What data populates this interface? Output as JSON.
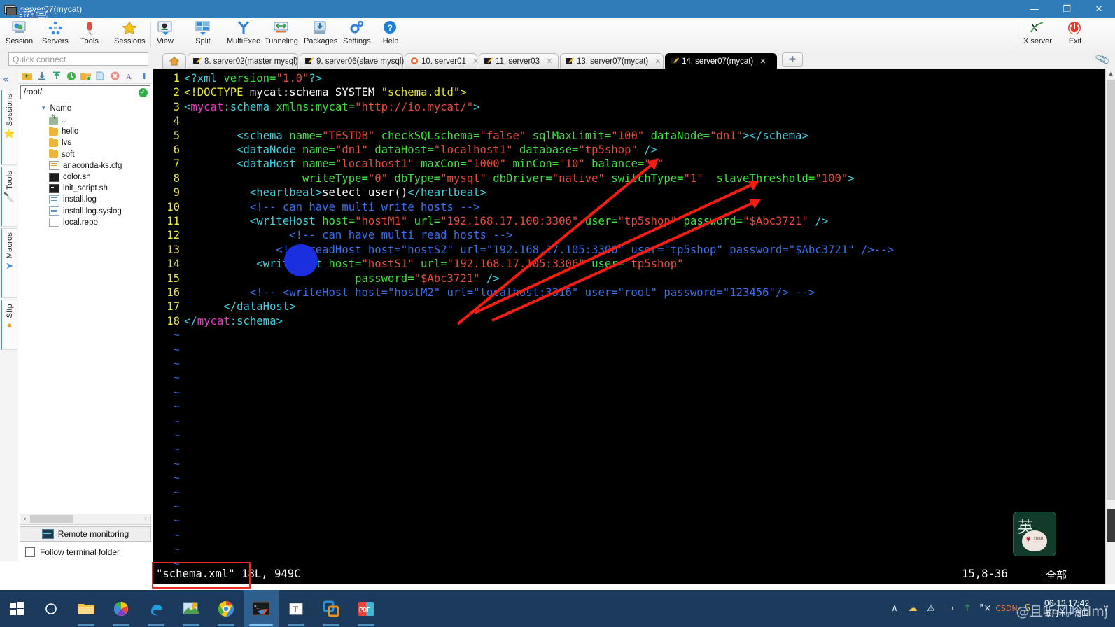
{
  "window": {
    "title": "server07(mycat)",
    "watermark_overlay": "暂停",
    "minimize_label": "—",
    "maximize_label": "❐",
    "close_label": "✕"
  },
  "ribbon": {
    "items": [
      {
        "label": "Session",
        "icon": "session-icon"
      },
      {
        "label": "Servers",
        "icon": "servers-icon"
      },
      {
        "label": "Tools",
        "icon": "tools-icon"
      },
      {
        "label": "Sessions",
        "icon": "sessions-star-icon"
      },
      {
        "label": "View",
        "icon": "view-icon"
      },
      {
        "label": "Split",
        "icon": "split-icon"
      },
      {
        "label": "MultiExec",
        "icon": "multiexec-icon"
      },
      {
        "label": "Tunneling",
        "icon": "tunneling-icon"
      },
      {
        "label": "Packages",
        "icon": "packages-icon"
      },
      {
        "label": "Settings",
        "icon": "settings-gear-icon"
      },
      {
        "label": "Help",
        "icon": "help-icon"
      }
    ],
    "right_items": [
      {
        "label": "X server",
        "icon": "x-server-icon"
      },
      {
        "label": "Exit",
        "icon": "power-exit-icon"
      }
    ]
  },
  "quick_connect": {
    "placeholder": "Quick connect..."
  },
  "tabs": {
    "home_icon": "home-icon",
    "items": [
      {
        "label": "8. server02(master mysql)",
        "icon": "terminal-pencil-icon",
        "active": false
      },
      {
        "label": "9. server06(slave mysql)",
        "icon": "terminal-pencil-icon",
        "active": false
      },
      {
        "label": "10. server01",
        "icon": "session-orange-icon",
        "active": false
      },
      {
        "label": "11. server03",
        "icon": "terminal-pencil-icon",
        "active": false
      },
      {
        "label": "13. server07(mycat)",
        "icon": "terminal-pencil-icon",
        "active": false
      },
      {
        "label": "14. server07(mycat)",
        "icon": "terminal-pencil-icon",
        "active": true
      }
    ],
    "new_tab_label": "+",
    "close_label": "✕"
  },
  "rail": {
    "collapse_label": "«",
    "tabs": [
      {
        "label": "Sessions",
        "icon": "star-icon"
      },
      {
        "label": "Tools",
        "icon": "swiss-knife-icon"
      },
      {
        "label": "Macros",
        "icon": "paper-plane-icon"
      },
      {
        "label": "Sftp",
        "icon": "sftp-globe-icon"
      }
    ]
  },
  "file_panel": {
    "toolbar_icons": [
      "up-folder-icon",
      "download-icon",
      "upload-icon",
      "refresh-icon",
      "new-folder-icon",
      "new-file-icon",
      "delete-icon",
      "rename-icon",
      "info-icon"
    ],
    "path": "/root/",
    "path_ok_icon": "check-icon",
    "column_header": "Name",
    "sort_caret": "▾",
    "files": [
      {
        "name": "..",
        "type": "up"
      },
      {
        "name": "hello",
        "type": "folder"
      },
      {
        "name": "lvs",
        "type": "folder"
      },
      {
        "name": "soft",
        "type": "folder"
      },
      {
        "name": "anaconda-ks.cfg",
        "type": "cfg"
      },
      {
        "name": "color.sh",
        "type": "sh"
      },
      {
        "name": "init_script.sh",
        "type": "sh"
      },
      {
        "name": "install.log",
        "type": "log"
      },
      {
        "name": "install.log.syslog",
        "type": "log"
      },
      {
        "name": "local.repo",
        "type": "plain"
      }
    ],
    "scroll_left": "‹",
    "scroll_right": "›",
    "remote_monitoring": "Remote monitoring",
    "follow_terminal_folder": "Follow terminal folder",
    "follow_checked": false
  },
  "terminal": {
    "lines": [
      {
        "n": "1",
        "segs": [
          {
            "t": "<?xml",
            "c": "c-tag"
          },
          {
            "t": " version=",
            "c": "c-attr"
          },
          {
            "t": "\"1.0\"",
            "c": "c-val"
          },
          {
            "t": "?>",
            "c": "c-tag"
          }
        ]
      },
      {
        "n": "2",
        "segs": [
          {
            "t": "<!DOCTYPE",
            "c": "c-pi"
          },
          {
            "t": " mycat:schema SYSTEM ",
            "c": "c-txt"
          },
          {
            "t": "\"schema.dtd\">",
            "c": "c-pi"
          }
        ]
      },
      {
        "n": "3",
        "segs": [
          {
            "t": "<",
            "c": "c-tag"
          },
          {
            "t": "mycat",
            "c": "c-ns"
          },
          {
            "t": ":schema",
            "c": "c-tag"
          },
          {
            "t": " xmlns:mycat=",
            "c": "c-attr"
          },
          {
            "t": "\"http://io.mycat/\"",
            "c": "c-val"
          },
          {
            "t": ">",
            "c": "c-tag"
          }
        ]
      },
      {
        "n": "4",
        "segs": []
      },
      {
        "n": "5",
        "segs": [
          {
            "t": "        <schema",
            "c": "c-tag"
          },
          {
            "t": " name=",
            "c": "c-attr"
          },
          {
            "t": "\"TESTDB\"",
            "c": "c-val"
          },
          {
            "t": " checkSQLschema=",
            "c": "c-attr"
          },
          {
            "t": "\"false\"",
            "c": "c-val"
          },
          {
            "t": " sqlMaxLimit=",
            "c": "c-attr"
          },
          {
            "t": "\"100\"",
            "c": "c-val"
          },
          {
            "t": " dataNode=",
            "c": "c-attr"
          },
          {
            "t": "\"dn1\"",
            "c": "c-val"
          },
          {
            "t": "></schema>",
            "c": "c-tag"
          }
        ]
      },
      {
        "n": "6",
        "segs": [
          {
            "t": "        <dataNode",
            "c": "c-tag"
          },
          {
            "t": " name=",
            "c": "c-attr"
          },
          {
            "t": "\"dn1\"",
            "c": "c-val"
          },
          {
            "t": " dataHost=",
            "c": "c-attr"
          },
          {
            "t": "\"localhost1\"",
            "c": "c-val"
          },
          {
            "t": " database=",
            "c": "c-attr"
          },
          {
            "t": "\"tp5shop\"",
            "c": "c-val"
          },
          {
            "t": " />",
            "c": "c-tag"
          }
        ]
      },
      {
        "n": "7",
        "segs": [
          {
            "t": "        <dataHost",
            "c": "c-tag"
          },
          {
            "t": " name=",
            "c": "c-attr"
          },
          {
            "t": "\"localhost1\"",
            "c": "c-val"
          },
          {
            "t": " maxCon=",
            "c": "c-attr"
          },
          {
            "t": "\"1000\"",
            "c": "c-val"
          },
          {
            "t": " minCon=",
            "c": "c-attr"
          },
          {
            "t": "\"10\"",
            "c": "c-val"
          },
          {
            "t": " balance=",
            "c": "c-attr"
          },
          {
            "t": "\"0\"",
            "c": "c-val"
          }
        ]
      },
      {
        "n": "8",
        "segs": [
          {
            "t": "                  writeType=",
            "c": "c-attr"
          },
          {
            "t": "\"0\"",
            "c": "c-val"
          },
          {
            "t": " dbType=",
            "c": "c-attr"
          },
          {
            "t": "\"mysql\"",
            "c": "c-val"
          },
          {
            "t": " dbDriver=",
            "c": "c-attr"
          },
          {
            "t": "\"native\"",
            "c": "c-val"
          },
          {
            "t": " switchType=",
            "c": "c-attr"
          },
          {
            "t": "\"1\"",
            "c": "c-val"
          },
          {
            "t": "  slaveThreshold=",
            "c": "c-attr"
          },
          {
            "t": "\"100\"",
            "c": "c-val"
          },
          {
            "t": ">",
            "c": "c-tag"
          }
        ]
      },
      {
        "n": "9",
        "segs": [
          {
            "t": "          <heartbeat>",
            "c": "c-tag"
          },
          {
            "t": "select user()",
            "c": "c-txt"
          },
          {
            "t": "</heartbeat>",
            "c": "c-tag"
          }
        ]
      },
      {
        "n": "10",
        "segs": [
          {
            "t": "          <!-- can have multi write hosts -->",
            "c": "c-com"
          }
        ]
      },
      {
        "n": "11",
        "segs": [
          {
            "t": "          <writeHost",
            "c": "c-tag"
          },
          {
            "t": " host=",
            "c": "c-attr"
          },
          {
            "t": "\"hostM1\"",
            "c": "c-val"
          },
          {
            "t": " url=",
            "c": "c-attr"
          },
          {
            "t": "\"192.168.17.100:3306\"",
            "c": "c-val"
          },
          {
            "t": " user=",
            "c": "c-attr"
          },
          {
            "t": "\"tp5shop\"",
            "c": "c-val"
          },
          {
            "t": " password=",
            "c": "c-attr"
          },
          {
            "t": "\"$Abc3721\"",
            "c": "c-val"
          },
          {
            "t": " />",
            "c": "c-tag"
          }
        ]
      },
      {
        "n": "12",
        "segs": [
          {
            "t": "                <!-- can have multi read hosts -->",
            "c": "c-com"
          }
        ]
      },
      {
        "n": "13",
        "segs": [
          {
            "t": "              <!--<readHost host=\"hostS2\" url=\"192.168.17.105:3306\" user=\"tp5shop\" password=\"$Abc3721\" />-->",
            "c": "c-com"
          }
        ]
      },
      {
        "n": "14",
        "segs": [
          {
            "t": "           <writeHost",
            "c": "c-tag"
          },
          {
            "t": " host=",
            "c": "c-attr"
          },
          {
            "t": "\"hostS1\"",
            "c": "c-val"
          },
          {
            "t": " url=",
            "c": "c-attr"
          },
          {
            "t": "\"192.168.17.105:3306\"",
            "c": "c-val"
          },
          {
            "t": " user=",
            "c": "c-attr"
          },
          {
            "t": "\"tp5shop\"",
            "c": "c-val"
          }
        ]
      },
      {
        "n": "15",
        "segs": [
          {
            "t": "                          password=",
            "c": "c-attr"
          },
          {
            "t": "\"$Abc3721\"",
            "c": "c-val"
          },
          {
            "t": " />",
            "c": "c-tag"
          }
        ]
      },
      {
        "n": "16",
        "segs": [
          {
            "t": "          <!-- <writeHost host=\"hostM2\" url=\"localhost:3316\" user=\"root\" password=\"123456\"/> -->",
            "c": "c-com"
          }
        ]
      },
      {
        "n": "17",
        "segs": [
          {
            "t": "      </dataHost>",
            "c": "c-tag"
          }
        ]
      },
      {
        "n": "18",
        "segs": [
          {
            "t": "</",
            "c": "c-tag"
          },
          {
            "t": "mycat",
            "c": "c-ns"
          },
          {
            "t": ":schema>",
            "c": "c-tag"
          }
        ]
      }
    ],
    "empty_marker": "~",
    "empty_line_count": 17,
    "status": {
      "filename": "\"schema.xml\"",
      "file_info": "18L, 949C",
      "cursor_position": "15,8-36",
      "scroll_indicator": "全部"
    }
  },
  "annotations": {
    "highlight_box_color": "#ee2a22",
    "arrow_color": "#f01d12",
    "cursor_blob_color": "#1b2fe0"
  },
  "ime": {
    "mode": "英",
    "sticker_text": "Heart"
  },
  "taskbar": {
    "start_icon": "windows-start-icon",
    "items": [
      {
        "icon": "cortana-search-icon",
        "state": "idle"
      },
      {
        "icon": "file-explorer-icon",
        "state": "run"
      },
      {
        "icon": "photos-icon",
        "state": "run"
      },
      {
        "icon": "edge-icon",
        "state": "run"
      },
      {
        "icon": "snipaste-icon",
        "state": "run"
      },
      {
        "icon": "chrome-icon",
        "state": "run"
      },
      {
        "icon": "mobaxterm-icon",
        "state": "active"
      },
      {
        "icon": "typora-icon",
        "state": "run"
      },
      {
        "icon": "vmware-icon",
        "state": "run"
      },
      {
        "icon": "pdf-reader-icon",
        "state": "run"
      }
    ],
    "tray": [
      {
        "icon": "show-hidden-icon",
        "glyph": "∧"
      },
      {
        "icon": "cloud-icon",
        "glyph": "☁"
      },
      {
        "icon": "warning-network-icon",
        "glyph": "⚠"
      },
      {
        "icon": "battery-icon",
        "glyph": "▭"
      },
      {
        "icon": "update-icon",
        "glyph": "↑"
      },
      {
        "icon": "volume-muted-icon",
        "glyph": "ᴿ×"
      },
      {
        "icon": "csdn-icon",
        "glyph": "CSDN"
      },
      {
        "icon": "sogou-ime-icon",
        "glyph": "S"
      }
    ],
    "clock_time": "06-13 17:42",
    "clock_date": "五月十一 周四",
    "watermark": "@且听风吟tlmj",
    "tray_expand": "∨"
  }
}
